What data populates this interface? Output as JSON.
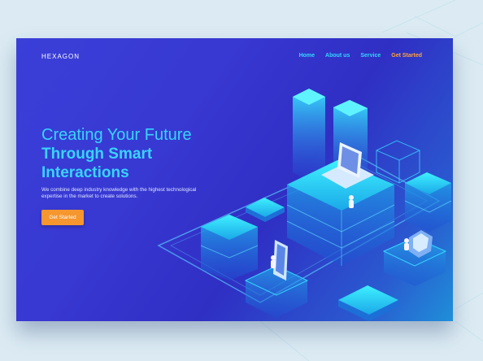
{
  "brand": {
    "name": "HEXAGON"
  },
  "nav": {
    "items": [
      "Home",
      "About us",
      "Service"
    ],
    "cta": "Get Started"
  },
  "hero": {
    "line1": "Creating Your Future",
    "line2": "Through Smart",
    "line3": "Interactions",
    "description": "We combine deep industry knowledge with the highest technological expertise in the market to create solutions.",
    "button": "Get Started"
  },
  "colors": {
    "accent": "#37d5ff",
    "cta": "#f5962f",
    "background": "#3a3fd8"
  }
}
